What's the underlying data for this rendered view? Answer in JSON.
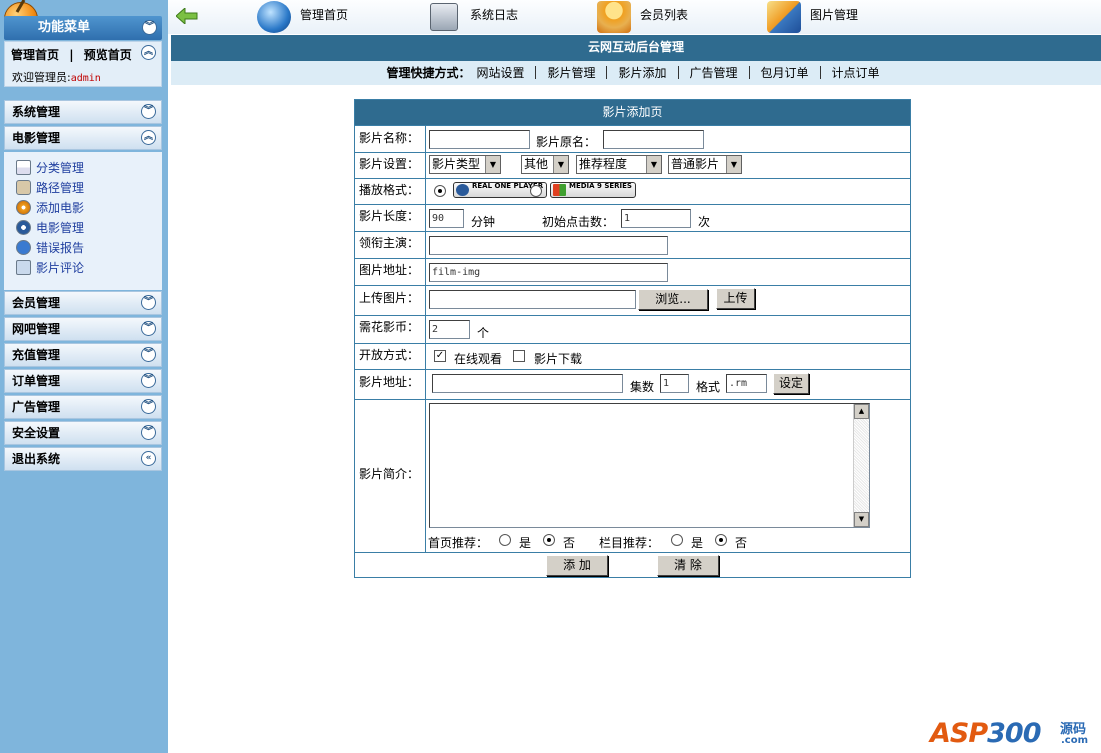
{
  "sidebar": {
    "title": "功能菜单",
    "nav_home": "管理首页",
    "nav_sep": "|",
    "nav_preview": "预览首页",
    "welcome_label": "欢迎管理员:",
    "welcome_user": "admin",
    "sections": {
      "system": "系统管理",
      "movie": "电影管理",
      "member": "会员管理",
      "netbar": "网吧管理",
      "recharge": "充值管理",
      "order": "订单管理",
      "ad": "广告管理",
      "security": "安全设置",
      "logout": "退出系统"
    },
    "movie_items": [
      "分类管理",
      "路径管理",
      "添加电影",
      "电影管理",
      "错误报告",
      "影片评论"
    ]
  },
  "toolbar": {
    "home": "管理首页",
    "log": "系统日志",
    "members": "会员列表",
    "pictures": "图片管理"
  },
  "header": {
    "title": "云网互动后台管理",
    "quick_label": "管理快捷方式：",
    "quick_links": [
      "网站设置",
      "影片管理",
      "影片添加",
      "广告管理",
      "包月订单",
      "计点订单"
    ]
  },
  "form": {
    "title": "影片添加页",
    "name_label": "影片名称：",
    "name_value": "",
    "origin_label": "影片原名：",
    "origin_value": "",
    "settings_label": "影片设置：",
    "select_type": "影片类型",
    "select_other": "其他",
    "select_rec": "推荐程度",
    "select_kind": "普通影片",
    "format_label": "播放格式：",
    "format_real": "REAL ONE PLAYER",
    "format_media": "MEDIA 9 SERIES",
    "length_label": "影片长度：",
    "length_value": "90",
    "length_unit": "分钟",
    "clicks_label": "初始点击数：",
    "clicks_value": "1",
    "clicks_unit": "次",
    "actor_label": "领衔主演：",
    "actor_value": "",
    "img_label": "图片地址：",
    "img_value": "film-img",
    "upload_label": "上传图片：",
    "browse_btn": "浏览...",
    "upload_btn": "上传",
    "coin_label": "需花影币：",
    "coin_value": "2",
    "coin_unit": "个",
    "open_label": "开放方式：",
    "open_online": "在线观看",
    "open_download": "影片下载",
    "addr_label": "影片地址：",
    "addr_value": "",
    "episode_label": "集数",
    "episode_value": "1",
    "fmt_label": "格式",
    "fmt_value": ".rm",
    "set_btn": "设定",
    "intro_label": "影片简介：",
    "home_rec_label": "首页推荐：",
    "col_rec_label": "栏目推荐：",
    "yes": "是",
    "no": "否",
    "add_btn": "添 加",
    "clear_btn": "清 除"
  },
  "watermark": {
    "main_a": "ASP",
    "main_b": "300",
    "cn": "源码",
    "com": ".com"
  }
}
